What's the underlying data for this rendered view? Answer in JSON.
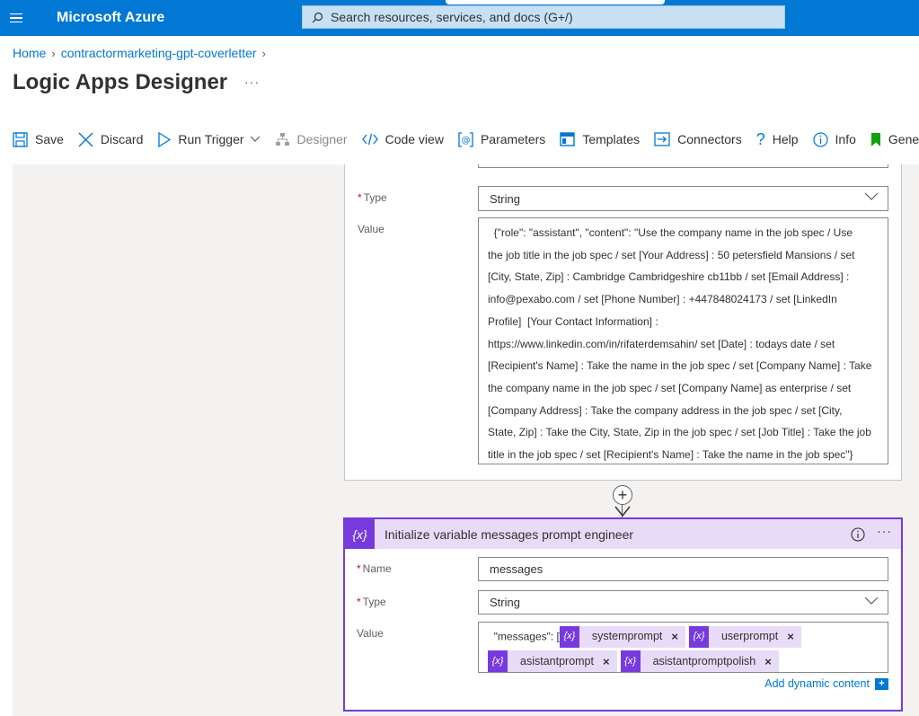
{
  "topbar": {
    "brand": "Microsoft Azure",
    "search_placeholder": "Search resources, services, and docs (G+/)"
  },
  "breadcrumb": {
    "home": "Home",
    "resource": "contractormarketing-gpt-coverletter"
  },
  "page": {
    "title": "Logic Apps Designer",
    "more": "···"
  },
  "toolbar": {
    "save": "Save",
    "discard": "Discard",
    "run_trigger": "Run Trigger",
    "designer": "Designer",
    "code_view": "Code view",
    "parameters": "Parameters",
    "templates": "Templates",
    "connectors": "Connectors",
    "help": "Help",
    "info": "Info",
    "generate": "Genera"
  },
  "card1": {
    "type_label": "Type",
    "type_value": "String",
    "value_label": "Value",
    "value_lines": [
      "  {\"role\": \"assistant\", \"content\": \"Use the company name in the job spec / Use",
      "the job title in the job spec / set [Your Address] : 50 petersfield Mansions / set",
      "[City, State, Zip] : Cambridge Cambridgeshire cb11bb / set [Email Address] :",
      "info@pexabo.com / set [Phone Number] : +447848024173 / set [LinkedIn",
      "Profile]  [Your Contact Information] :",
      "https://www.linkedin.com/in/rifaterdemsahin/ set [Date] : todays date / set",
      "[Recipient's Name] : Take the name in the job spec / set [Company Name] : Take",
      "the company name in the job spec / set [Company Name] as enterprise / set",
      "[Company Address] : Take the company address in the job spec / set [City,",
      "State, Zip] : Take the City, State, Zip in the job spec / set [Job Title] : Take the job",
      "title in the job spec / set [Recipient's Name] : Take the name in the job spec\"}"
    ]
  },
  "card2": {
    "icon": "{x}",
    "title": "Initialize variable messages prompt engineer",
    "name_label": "Name",
    "name_value": "messages",
    "type_label": "Type",
    "type_value": "String",
    "value_label": "Value",
    "value_prefix": "  \"messages\": [",
    "tokens": [
      {
        "label": "systemprompt"
      },
      {
        "label": "userprompt"
      },
      {
        "label": "asistantprompt"
      },
      {
        "label": "asistantpromptpolish"
      }
    ],
    "add_dynamic": "Add dynamic content"
  }
}
